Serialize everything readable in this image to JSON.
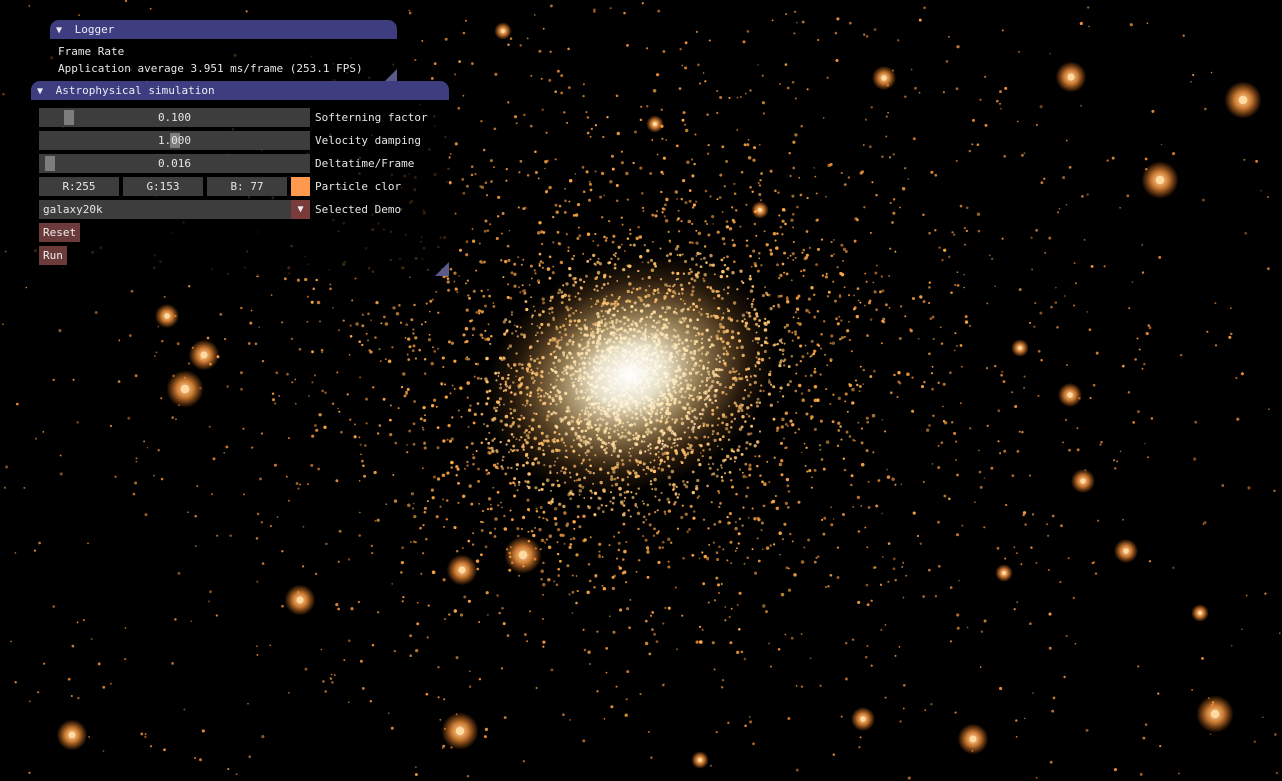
{
  "logger": {
    "title": "Logger",
    "lines": [
      "Frame Rate",
      "Application average 3.951 ms/frame (253.1 FPS)"
    ]
  },
  "simulation": {
    "title": "Astrophysical simulation",
    "softening": {
      "value": "0.100",
      "label": "Softerning factor",
      "fraction": 0.1
    },
    "damping": {
      "value": "1.000",
      "label": "Velocity damping",
      "fraction": 0.5
    },
    "deltatime": {
      "value": "0.016",
      "label": "Deltatime/Frame",
      "fraction": 0.016
    },
    "color": {
      "r": "R:255",
      "g": "G:153",
      "b": "B: 77",
      "label": "Particle clor",
      "swatch": "#ff994d"
    },
    "demo": {
      "value": "galaxy20k",
      "label": "Selected Demo"
    },
    "reset_label": "Reset",
    "run_label": "Run"
  },
  "icons": {
    "collapse": "collapse-arrow-icon",
    "dropdown": "chevron-down-icon"
  },
  "colors": {
    "title_bar": "#3d3d80",
    "widget_bg": "#3d3d3d",
    "button": "#6b3a3a",
    "particle": "#ff994d"
  }
}
